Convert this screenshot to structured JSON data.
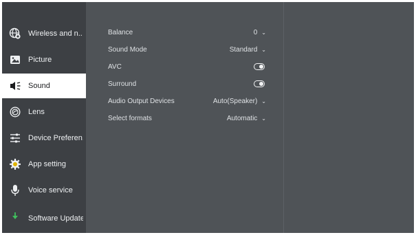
{
  "sidebar": {
    "items": [
      {
        "label": "Wireless and n..",
        "icon": "globe-icon"
      },
      {
        "label": "Picture",
        "icon": "picture-icon"
      },
      {
        "label": "Sound",
        "icon": "speaker-icon",
        "active": true
      },
      {
        "label": "Lens",
        "icon": "lens-icon"
      },
      {
        "label": "Device Preferen..",
        "icon": "preferences-icon"
      },
      {
        "label": "App setting",
        "icon": "gear-icon"
      },
      {
        "label": "Voice service",
        "icon": "microphone-icon"
      },
      {
        "label": "Software Update",
        "icon": "download-icon"
      }
    ]
  },
  "settings": {
    "balance": {
      "label": "Balance",
      "value": "0"
    },
    "sound_mode": {
      "label": "Sound Mode",
      "value": "Standard"
    },
    "avc": {
      "label": "AVC",
      "on": true
    },
    "surround": {
      "label": "Surround",
      "on": true
    },
    "audio_output": {
      "label": "Audio Output Devices",
      "value": "Auto(Speaker)"
    },
    "select_formats": {
      "label": "Select formats",
      "value": "Automatic"
    }
  },
  "colors": {
    "background": "#4f5357",
    "sidebar": "#3d4044",
    "active_item": "#ffffff",
    "text": "#dfe2e5"
  }
}
